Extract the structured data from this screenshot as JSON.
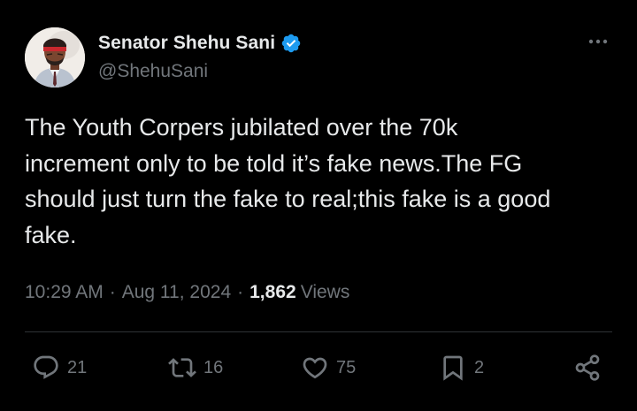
{
  "author": {
    "display_name": "Senator Shehu Sani",
    "handle": "@ShehuSani",
    "avatar_icon": "profile-photo",
    "verified": true
  },
  "tweet": {
    "text": "The Youth Corpers jubilated over the 70k\nincrement only to be told it’s fake news.The FG\nshould just turn the fake to real;this fake is a good\nfake."
  },
  "meta": {
    "time": "10:29 AM",
    "separator": "·",
    "date": "Aug 11, 2024",
    "views_count": "1,862",
    "views_label": "Views"
  },
  "actions": {
    "replies": "21",
    "reposts": "16",
    "likes": "75",
    "bookmarks": "2"
  },
  "colors": {
    "background": "#000000",
    "text_primary": "#e7e9ea",
    "text_secondary": "#71767b",
    "verified_badge": "#1d9bf0",
    "divider": "#2f3336"
  }
}
